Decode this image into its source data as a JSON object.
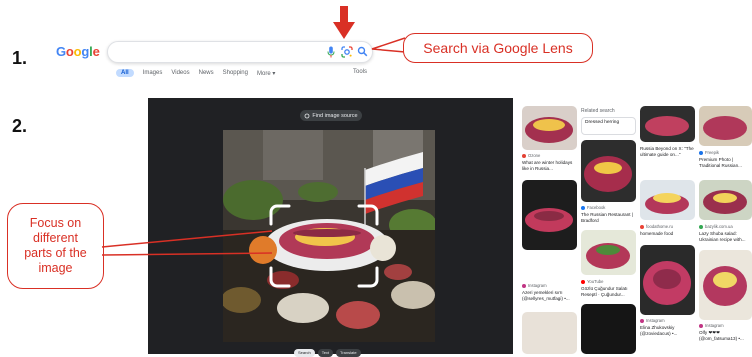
{
  "steps": {
    "one": "1.",
    "two": "2."
  },
  "google_logo": {
    "letters": [
      "G",
      "o",
      "o",
      "g",
      "l",
      "e"
    ],
    "colors": [
      "#4285F4",
      "#EA4335",
      "#FBBC05",
      "#4285F4",
      "#34A853",
      "#EA4335"
    ]
  },
  "search_tabs": [
    "All",
    "Images",
    "Videos",
    "News",
    "Shopping",
    "More ▾"
  ],
  "tools_label": "Tools",
  "callouts": {
    "lens": "Search via Google Lens",
    "focus": [
      "Focus on",
      "different",
      "parts of the",
      "image"
    ]
  },
  "lens": {
    "find_source": "Find image source",
    "bottom_tabs": [
      "Search",
      "Text",
      "Translate"
    ],
    "active_bottom_tab": "Search"
  },
  "related": {
    "label": "Related search",
    "chip": "Dressed herring"
  },
  "results": [
    {
      "source": "Ozone",
      "caption": "What are winter holidays like in Russia..."
    },
    {
      "source": "",
      "caption": "Russia Beyond on X: \"The ultimate guide on...\""
    },
    {
      "source": "Freepik",
      "caption": "Premium Photo | Traditional Russian..."
    },
    {
      "source": "Facebook",
      "caption": "The Russian Restaurant | Bradford"
    },
    {
      "source": "foodathome.ru",
      "caption": "homemade food"
    },
    {
      "source": "bazylik.com.ua",
      "caption": "Lazy Shuba salad: Ukrainian recipe with..."
    },
    {
      "source": "YouTube",
      "caption": "Gözlü Çuğundur Salatı Reseptİ · Çuğundur..."
    },
    {
      "source": "Instagram",
      "caption": "Azeri yemekleri sırrı (@sellyres_mutfagi) •..."
    },
    {
      "source": "Instagram",
      "caption": "Elina Zhukovskiy (@zoviedacus) •..."
    },
    {
      "source": "Instagram",
      "caption": "Olfy ❤❤❤ (@om_fatsuma13) •..."
    }
  ],
  "colors": {
    "accent_red": "#d93025",
    "lens_bg": "#202124"
  }
}
